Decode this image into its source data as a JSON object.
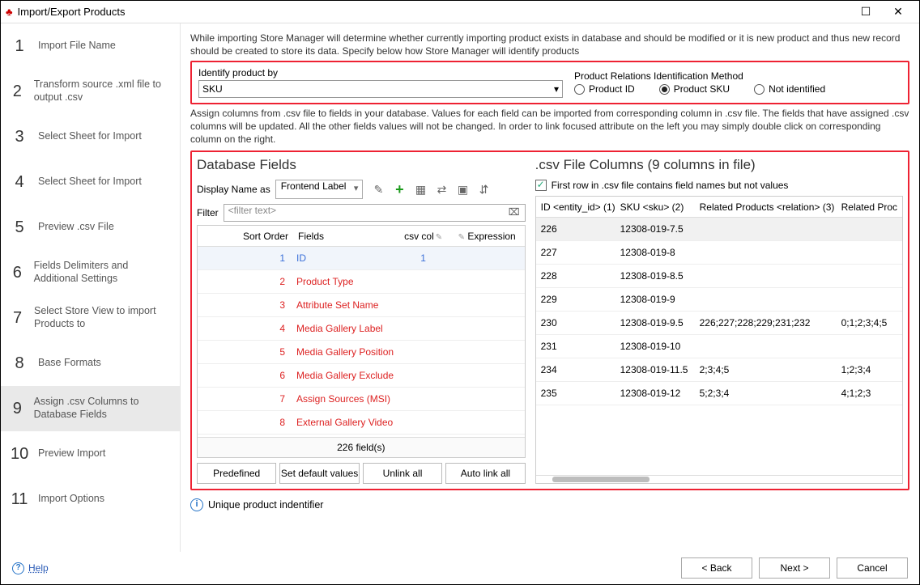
{
  "window": {
    "title": "Import/Export Products"
  },
  "sidebar": {
    "steps": [
      {
        "n": "1",
        "label": "Import File Name"
      },
      {
        "n": "2",
        "label": "Transform source .xml file to output .csv"
      },
      {
        "n": "3",
        "label": "Select Sheet for Import"
      },
      {
        "n": "4",
        "label": "Select Sheet for Import"
      },
      {
        "n": "5",
        "label": "Preview .csv File"
      },
      {
        "n": "6",
        "label": "Fields Delimiters and Additional Settings"
      },
      {
        "n": "7",
        "label": "Select Store View to import Products to"
      },
      {
        "n": "8",
        "label": "Base Formats"
      },
      {
        "n": "9",
        "label": "Assign .csv Columns to Database Fields"
      },
      {
        "n": "10",
        "label": "Preview Import"
      },
      {
        "n": "11",
        "label": "Import Options"
      }
    ],
    "activeIndex": 8
  },
  "intro": "While importing Store Manager will determine whether currently importing product exists in database and should be modified or it is new product and thus new record should be created to store its data. Specify below how Store Manager will identify products",
  "identify": {
    "label": "Identify product by",
    "value": "SKU",
    "groupLabel": "Product Relations Identification Method",
    "options": [
      {
        "label": "Product ID",
        "selected": false
      },
      {
        "label": "Product SKU",
        "selected": true
      },
      {
        "label": "Not identified",
        "selected": false
      }
    ]
  },
  "assignText": "Assign columns from .csv file to fields in your database. Values for each field can be imported from corresponding column in .csv file. The fields that have assigned .csv columns will be updated. All the other fields values will not be changed. In order to link focused attribute on the left you may simply double click on corresponding column on the right.",
  "db": {
    "title": "Database Fields",
    "displayLabel": "Display Name as",
    "displayValue": "Frontend Label",
    "filterLabel": "Filter",
    "filterPlaceholder": "<filter text>",
    "cols": {
      "sort": "Sort Order",
      "field": "Fields",
      "csv": "csv col",
      "exp": "Expression"
    },
    "rows": [
      {
        "so": "1",
        "fld": "ID",
        "csv": "1",
        "red": false
      },
      {
        "so": "2",
        "fld": "Product Type",
        "csv": "",
        "red": true
      },
      {
        "so": "3",
        "fld": "Attribute Set Name",
        "csv": "",
        "red": true
      },
      {
        "so": "4",
        "fld": "Media Gallery Label",
        "csv": "",
        "red": true
      },
      {
        "so": "5",
        "fld": "Media Gallery Position",
        "csv": "",
        "red": true
      },
      {
        "so": "6",
        "fld": "Media Gallery Exclude",
        "csv": "",
        "red": true
      },
      {
        "so": "7",
        "fld": "Assign Sources (MSI)",
        "csv": "",
        "red": true
      },
      {
        "so": "8",
        "fld": "External Gallery Video",
        "csv": "",
        "red": true
      }
    ],
    "footer": "226 field(s)",
    "buttons": [
      "Predefined",
      "Set default values",
      "Unlink all",
      "Auto link all"
    ]
  },
  "csv": {
    "title": ".csv File Columns (9 columns in file)",
    "checkbox": "First row in .csv file contains field names but not values",
    "cols": [
      "ID <entity_id> (1)",
      "SKU <sku> (2)",
      "Related Products <relation> (3)",
      "Related Proc"
    ],
    "rows": [
      {
        "c1": "226",
        "c2": "12308-019-7.5",
        "c3": "",
        "c4": ""
      },
      {
        "c1": "227",
        "c2": "12308-019-8",
        "c3": "",
        "c4": ""
      },
      {
        "c1": "228",
        "c2": "12308-019-8.5",
        "c3": "",
        "c4": ""
      },
      {
        "c1": "229",
        "c2": "12308-019-9",
        "c3": "",
        "c4": ""
      },
      {
        "c1": "230",
        "c2": "12308-019-9.5",
        "c3": "226;227;228;229;231;232",
        "c4": "0;1;2;3;4;5"
      },
      {
        "c1": "231",
        "c2": "12308-019-10",
        "c3": "",
        "c4": ""
      },
      {
        "c1": "234",
        "c2": "12308-019-11.5",
        "c3": "2;3;4;5",
        "c4": "1;2;3;4"
      },
      {
        "c1": "235",
        "c2": "12308-019-12",
        "c3": "5;2;3;4",
        "c4": "4;1;2;3"
      }
    ]
  },
  "info": "Unique product indentifier",
  "footer": {
    "help": "Help",
    "back": "< Back",
    "next": "Next >",
    "cancel": "Cancel"
  }
}
